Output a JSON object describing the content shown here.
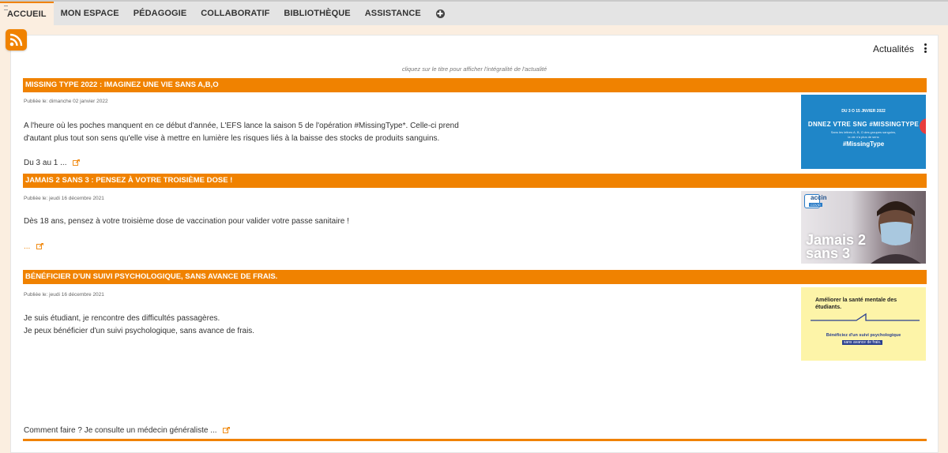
{
  "nav": {
    "tabs": [
      {
        "label": "ACCUEIL",
        "active": true
      },
      {
        "label": "MON ESPACE",
        "active": false
      },
      {
        "label": "PÉDAGOGIE",
        "active": false
      },
      {
        "label": "COLLABORATIF",
        "active": false
      },
      {
        "label": "BIBLIOTHÈQUE",
        "active": false
      },
      {
        "label": "ASSISTANCE",
        "active": false
      }
    ],
    "add_icon": "plus-circle-icon"
  },
  "colors": {
    "accent": "#f08200",
    "nav_bg": "#e4e4e4",
    "page_bg": "#fbeee0"
  },
  "panel": {
    "title": "Actualités",
    "hint": "cliquez sur le titre pour afficher l'intégralité de l'actualité"
  },
  "news": [
    {
      "title": "MISSING TYPE 2022 : IMAGINEZ UNE VIE SANS A,B,O",
      "date": "Publiée le: dimanche 02 janvier 2022",
      "paragraphs": [
        "A l'heure où les poches manquent en ce début d'année, L'EFS lance la saison 5 de l'opération #MissingType*. Celle-ci prend",
        "d'autant plus tout son sens qu'elle vise à mettre en lumière les risques liés à la baisse des stocks de produits sanguins."
      ],
      "more": "Du 3 au 1 ...",
      "image": {
        "line1": "DU 3 O 15 JNVIER 2022",
        "line2": "DNNEZ VTRE SNG",
        "line2b": "#MISSINGTYPE",
        "line3": "Sans les lettres A, B, O des groupes sanguins,",
        "line4": "la vie n'a plus de sens",
        "brand": "#MissingType"
      }
    },
    {
      "title": "JAMAIS 2 SANS 3 : PENSEZ À VOTRE TROISIÈME DOSE !",
      "date": "Publiée le: jeudi 16 décembre 2021",
      "paragraphs": [
        "Dès 18 ans, pensez à votre troisième dose de vaccination pour valider votre passe sanitaire !"
      ],
      "more": "...",
      "image": {
        "logo": "accin",
        "logo_sub": "COVID",
        "line1": "Jamais 2",
        "line2": "sans 3"
      }
    },
    {
      "title": "BÉNÉFICIER D'UN SUIVI PSYCHOLOGIQUE, SANS AVANCE DE FRAIS.",
      "date": "Publiée le: jeudi 16 décembre 2021",
      "paragraphs": [
        "Je suis étudiant, je rencontre des difficultés passagères.",
        "Je peux bénéficier d'un suivi psychologique, sans avance de frais."
      ],
      "more": "Comment faire ? Je consulte un médecin généraliste ...",
      "image": {
        "line1": "Améliorer la santé mentale des",
        "line2": "étudiants.",
        "line3": "Bénéficiez d'un suivi psychologique",
        "line4": "sans avance de frais."
      }
    }
  ]
}
